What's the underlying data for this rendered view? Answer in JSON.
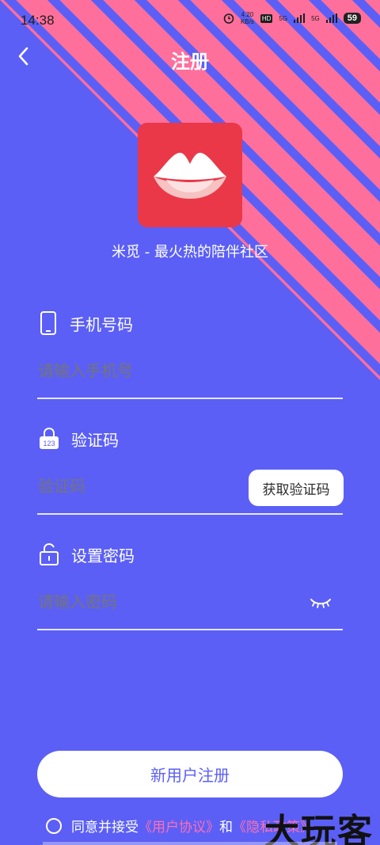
{
  "status_bar": {
    "time": "14:38",
    "net_speed_value": "4.20",
    "net_speed_unit": "KB/s",
    "hd_label": "HD",
    "signal_1": "5G",
    "signal_2": "5G",
    "battery": "59"
  },
  "header": {
    "title": "注册",
    "back_icon": "chevron-left-icon"
  },
  "logo": {
    "icon": "lips-logo-icon",
    "color": "#ea3848"
  },
  "tagline": "米觅 - 最火热的陪伴社区",
  "form": {
    "phone": {
      "label": "手机号码",
      "icon": "phone-icon",
      "placeholder": "请输入手机号"
    },
    "code": {
      "label": "验证码",
      "icon": "keypad-lock-icon",
      "placeholder": "验证码",
      "button": "获取验证码"
    },
    "password": {
      "label": "设置密码",
      "icon": "unlock-icon",
      "placeholder": "请输入密码",
      "toggle_icon": "eye-closed-icon"
    }
  },
  "register_button": "新用户注册",
  "agreement": {
    "prefix": "同意并接受",
    "user_agreement": "《用户协议》",
    "and": "和",
    "privacy_policy": "《隐私政策》"
  },
  "watermark": "大玩客",
  "colors": {
    "background": "#5b5ff6",
    "stripe": "#ff6f9c",
    "link": "#ff6fb3"
  }
}
